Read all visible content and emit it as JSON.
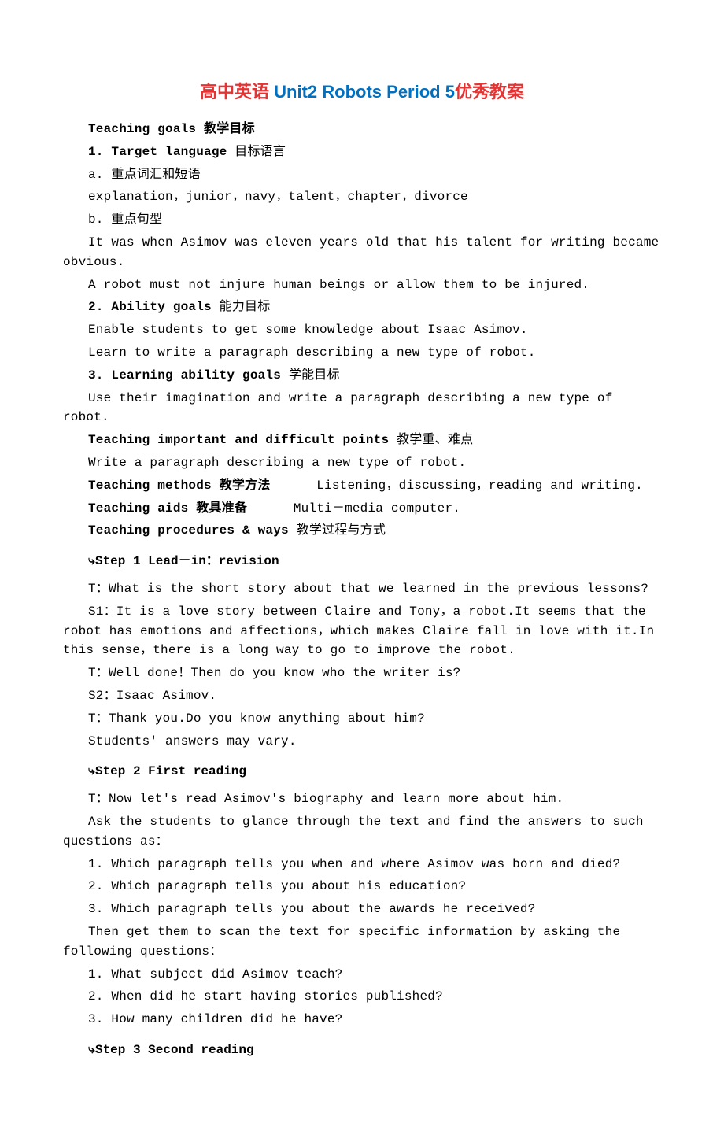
{
  "title": {
    "cn_prefix": "高中英语 ",
    "unit": "Unit2 Robots Period 5",
    "cn_suffix": "优秀教案"
  },
  "goals": {
    "header_en": "Teaching goals ",
    "header_cn": "教学目标",
    "s1": {
      "en": "1. Target language",
      "cn": "目标语言"
    },
    "a_label": "a. 重点词汇和短语",
    "vocab": "explanation，junior，navy，talent，chapter，divorce",
    "b_label": "b. 重点句型",
    "sent1": "It was when Asimov was eleven years old that his talent for writing became obvious.",
    "sent2": "A robot must not injure human beings or allow them to be injured.",
    "s2": {
      "en": "2. Ability goals ",
      "cn": "能力目标"
    },
    "ability1": "Enable students to get some knowledge about Isaac Asimov.",
    "ability2": "Learn to write a paragraph describing a new type of robot.",
    "s3": {
      "en": "3. Learning ability goals",
      "cn": "学能目标"
    },
    "learning1": "Use their imagination and write a paragraph describing a new type of robot.",
    "imp": {
      "en": "Teaching important and difficult points",
      "cn": "教学重、难点"
    },
    "imp_body": "Write a paragraph describing a new type of robot.",
    "methods": {
      "en": "Teaching methods",
      "cn": "教学方法",
      "body": "Listening，discussing，reading and writing."
    },
    "aids": {
      "en": "Teaching aids ",
      "cn": "教具准备",
      "body": "Multi－media computer."
    },
    "proc": {
      "en": "Teaching procedures & ways ",
      "cn": "教学过程与方式"
    }
  },
  "step1": {
    "heading": "Step 1  Lead－in：revision",
    "arrow": "⤷",
    "p1": "T：What is the short story about that we learned in the previous lessons?",
    "p2": "S1：It is a love story between Claire and Tony，a robot.It seems that the robot has emotions and affections，which makes Claire fall in love with it.In this sense，there is a long way to go to improve the robot.",
    "p3": "T：Well done！Then do you know who the writer is?",
    "p4": "S2：Isaac Asimov.",
    "p5": "T：Thank you.Do you know anything about him?",
    "p6": "Students' answers may vary."
  },
  "step2": {
    "heading": "Step 2  First reading",
    "arrow": "⤷",
    "p1": "T：Now let's read Asimov's biography and learn more about him.",
    "p2": "Ask the students to glance through the text and find the answers to such questions as：",
    "q1": "1. Which paragraph tells you when and where Asimov was born and died?",
    "q2": "2. Which paragraph tells you about  his education?",
    "q3": "3. Which paragraph tells you about the awards he received?",
    "p3": "Then get them to scan the text for specific information by asking the following questions：",
    "q4": "1. What subject did Asimov teach?",
    "q5": "2. When did he start having stories published?",
    "q6": "3. How many children did he have?"
  },
  "step3": {
    "heading": "Step 3  Second reading",
    "arrow": "⤷"
  }
}
